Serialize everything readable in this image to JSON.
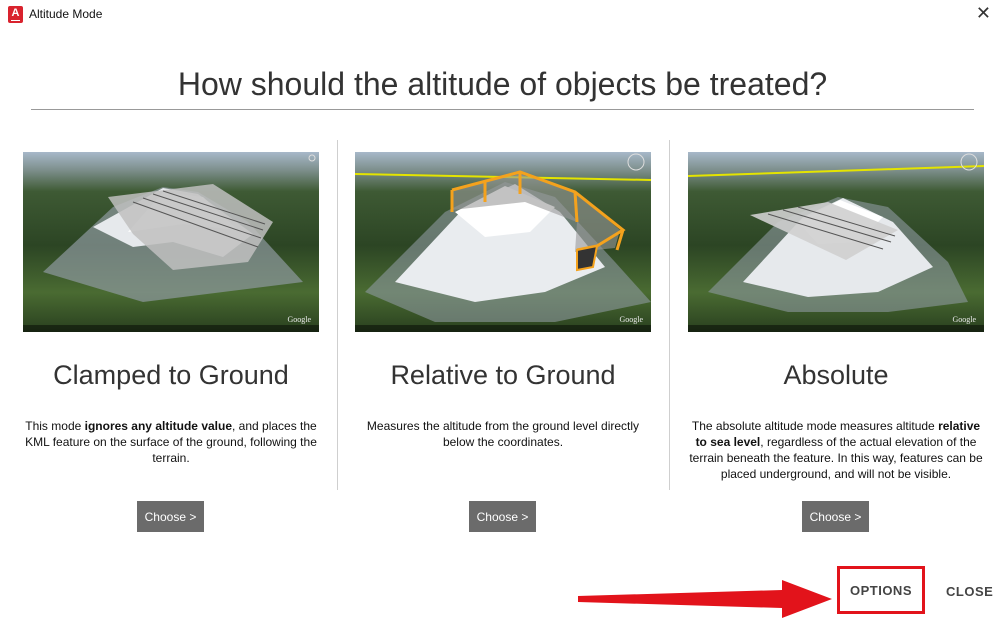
{
  "window": {
    "app_icon": "A",
    "title": "Altitude Mode",
    "close_glyph": "✕"
  },
  "heading": "How should the altitude of objects be treated?",
  "panels": [
    {
      "title": "Clamped to Ground",
      "desc_pre": "This mode ",
      "desc_bold": "ignores any altitude value",
      "desc_post": ", and places the KML feature on the surface of the ground, following the terrain.",
      "button": "Choose >"
    },
    {
      "title": "Relative to Ground",
      "desc_pre": "Measures the altitude from the ground level directly below the coordinates.",
      "desc_bold": "",
      "desc_post": "",
      "button": "Choose >"
    },
    {
      "title": "Absolute",
      "desc_pre": "The absolute altitude mode measures altitude ",
      "desc_bold": "relative to sea level",
      "desc_post": ", regardless of the actual elevation of the terrain beneath the feature. In this way, features can be placed underground, and will not be visible.",
      "button": "Choose >"
    }
  ],
  "thumb_logo": "Google",
  "footer": {
    "options": "OPTIONS",
    "close": "CLOSE"
  },
  "colors": {
    "accent_red": "#e2131b",
    "button_gray": "#6b6b6b"
  }
}
